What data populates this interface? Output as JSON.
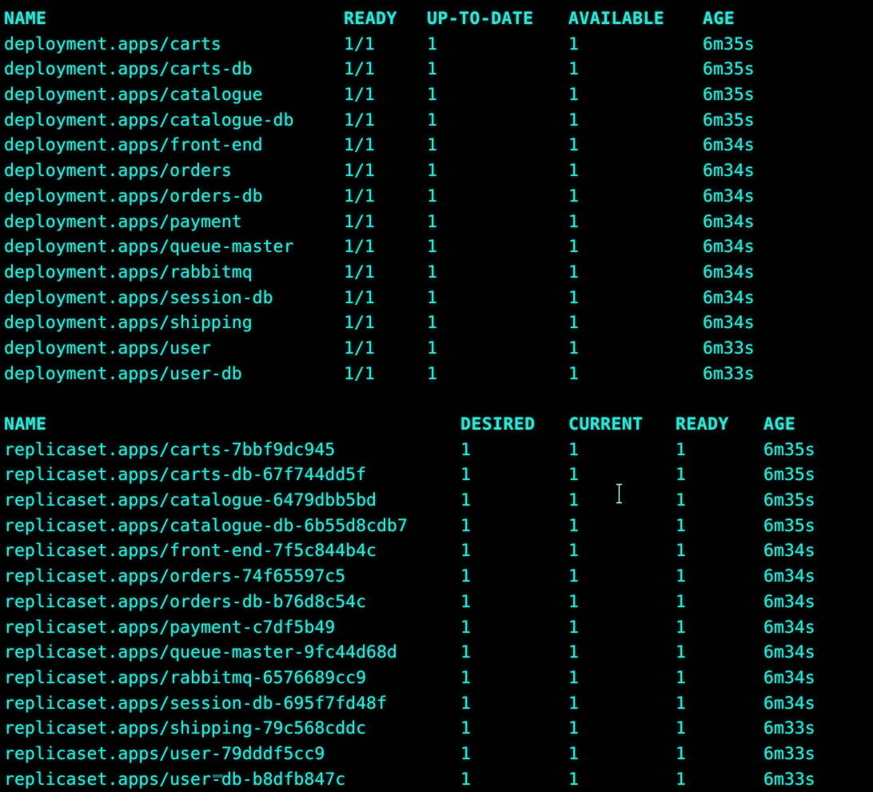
{
  "terminal": {
    "background_color": "#000000",
    "text_color": "#30e3d4",
    "cursor_icon": "text-ibeam-cursor"
  },
  "deployments_table": {
    "headers": {
      "name": "NAME",
      "ready": "READY",
      "up_to_date": "UP-TO-DATE",
      "available": "AVAILABLE",
      "age": "AGE"
    },
    "rows": [
      {
        "name": "deployment.apps/carts",
        "ready": "1/1",
        "up_to_date": "1",
        "available": "1",
        "age": "6m35s"
      },
      {
        "name": "deployment.apps/carts-db",
        "ready": "1/1",
        "up_to_date": "1",
        "available": "1",
        "age": "6m35s"
      },
      {
        "name": "deployment.apps/catalogue",
        "ready": "1/1",
        "up_to_date": "1",
        "available": "1",
        "age": "6m35s"
      },
      {
        "name": "deployment.apps/catalogue-db",
        "ready": "1/1",
        "up_to_date": "1",
        "available": "1",
        "age": "6m35s"
      },
      {
        "name": "deployment.apps/front-end",
        "ready": "1/1",
        "up_to_date": "1",
        "available": "1",
        "age": "6m34s"
      },
      {
        "name": "deployment.apps/orders",
        "ready": "1/1",
        "up_to_date": "1",
        "available": "1",
        "age": "6m34s"
      },
      {
        "name": "deployment.apps/orders-db",
        "ready": "1/1",
        "up_to_date": "1",
        "available": "1",
        "age": "6m34s"
      },
      {
        "name": "deployment.apps/payment",
        "ready": "1/1",
        "up_to_date": "1",
        "available": "1",
        "age": "6m34s"
      },
      {
        "name": "deployment.apps/queue-master",
        "ready": "1/1",
        "up_to_date": "1",
        "available": "1",
        "age": "6m34s"
      },
      {
        "name": "deployment.apps/rabbitmq",
        "ready": "1/1",
        "up_to_date": "1",
        "available": "1",
        "age": "6m34s"
      },
      {
        "name": "deployment.apps/session-db",
        "ready": "1/1",
        "up_to_date": "1",
        "available": "1",
        "age": "6m34s"
      },
      {
        "name": "deployment.apps/shipping",
        "ready": "1/1",
        "up_to_date": "1",
        "available": "1",
        "age": "6m34s"
      },
      {
        "name": "deployment.apps/user",
        "ready": "1/1",
        "up_to_date": "1",
        "available": "1",
        "age": "6m33s"
      },
      {
        "name": "deployment.apps/user-db",
        "ready": "1/1",
        "up_to_date": "1",
        "available": "1",
        "age": "6m33s"
      }
    ]
  },
  "replicasets_table": {
    "headers": {
      "name": "NAME",
      "desired": "DESIRED",
      "current": "CURRENT",
      "ready": "READY",
      "age": "AGE"
    },
    "rows": [
      {
        "name": "replicaset.apps/carts-7bbf9dc945",
        "desired": "1",
        "current": "1",
        "ready": "1",
        "age": "6m35s"
      },
      {
        "name": "replicaset.apps/carts-db-67f744dd5f",
        "desired": "1",
        "current": "1",
        "ready": "1",
        "age": "6m35s"
      },
      {
        "name": "replicaset.apps/catalogue-6479dbb5bd",
        "desired": "1",
        "current": "1",
        "ready": "1",
        "age": "6m35s"
      },
      {
        "name": "replicaset.apps/catalogue-db-6b55d8cdb7",
        "desired": "1",
        "current": "1",
        "ready": "1",
        "age": "6m35s"
      },
      {
        "name": "replicaset.apps/front-end-7f5c844b4c",
        "desired": "1",
        "current": "1",
        "ready": "1",
        "age": "6m34s"
      },
      {
        "name": "replicaset.apps/orders-74f65597c5",
        "desired": "1",
        "current": "1",
        "ready": "1",
        "age": "6m34s"
      },
      {
        "name": "replicaset.apps/orders-db-b76d8c54c",
        "desired": "1",
        "current": "1",
        "ready": "1",
        "age": "6m34s"
      },
      {
        "name": "replicaset.apps/payment-c7df5b49",
        "desired": "1",
        "current": "1",
        "ready": "1",
        "age": "6m34s"
      },
      {
        "name": "replicaset.apps/queue-master-9fc44d68d",
        "desired": "1",
        "current": "1",
        "ready": "1",
        "age": "6m34s"
      },
      {
        "name": "replicaset.apps/rabbitmq-6576689cc9",
        "desired": "1",
        "current": "1",
        "ready": "1",
        "age": "6m34s"
      },
      {
        "name": "replicaset.apps/session-db-695f7fd48f",
        "desired": "1",
        "current": "1",
        "ready": "1",
        "age": "6m34s"
      },
      {
        "name": "replicaset.apps/shipping-79c568cddc",
        "desired": "1",
        "current": "1",
        "ready": "1",
        "age": "6m33s"
      },
      {
        "name": "replicaset.apps/user-79dddf5cc9",
        "desired": "1",
        "current": "1",
        "ready": "1",
        "age": "6m33s"
      },
      {
        "name": "replicaset.apps/user-db-b8dfb847c",
        "desired": "1",
        "current": "1",
        "ready": "1",
        "age": "6m33s"
      }
    ]
  }
}
